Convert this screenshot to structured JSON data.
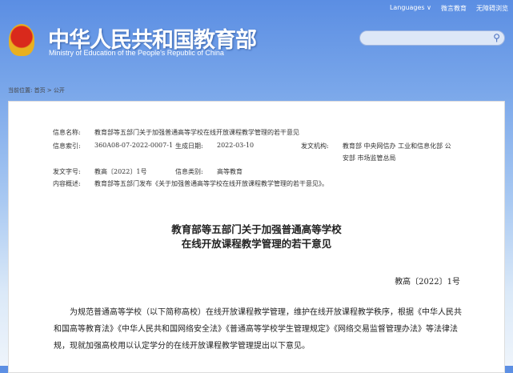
{
  "header": {
    "languages": "Languages ∨",
    "weiyan": "微言教育",
    "accessible": "无障碍浏览",
    "title": "中华人民共和国教育部",
    "subtitle": "Ministry of Education of the People's Republic of China",
    "search_placeholder": ""
  },
  "breadcrumb": "当前位置: 首页 > 公开",
  "meta": {
    "name_label": "信息名称:",
    "name": "教育部等五部门关于加强普通高等学校在线开放课程教学管理的若干意见",
    "index_label": "信息索引:",
    "index": "360A08-07-2022-0007-1",
    "date_label": "生成日期:",
    "date": "2022-03-10",
    "org_label": "发文机构:",
    "org1": "教育部 中央网信办 工业和信息化部 公",
    "org2": "安部 市场监管总局",
    "docno_label": "发文字号:",
    "docno": "教高〔2022〕1号",
    "cat_label": "信息类别:",
    "cat": "高等教育",
    "summary_label": "内容概述:",
    "summary": "教育部等五部门发布《关于加强普通高等学校在线开放课程教学管理的若干意见》。"
  },
  "article": {
    "title1": "教育部等五部门关于加强普通高等学校",
    "title2": "在线开放课程教学管理的若干意见",
    "docno": "教高〔2022〕1号",
    "para": "为规范普通高等学校（以下简称高校）在线开放课程教学管理，维护在线开放课程教学秩序，根据《中华人民共和国高等教育法》《中华人民共和国网络安全法》《普通高等学校学生管理规定》《网络交易监督管理办法》等法律法规，现就加强高校用以认定学分的在线开放课程教学管理提出以下意见。"
  }
}
